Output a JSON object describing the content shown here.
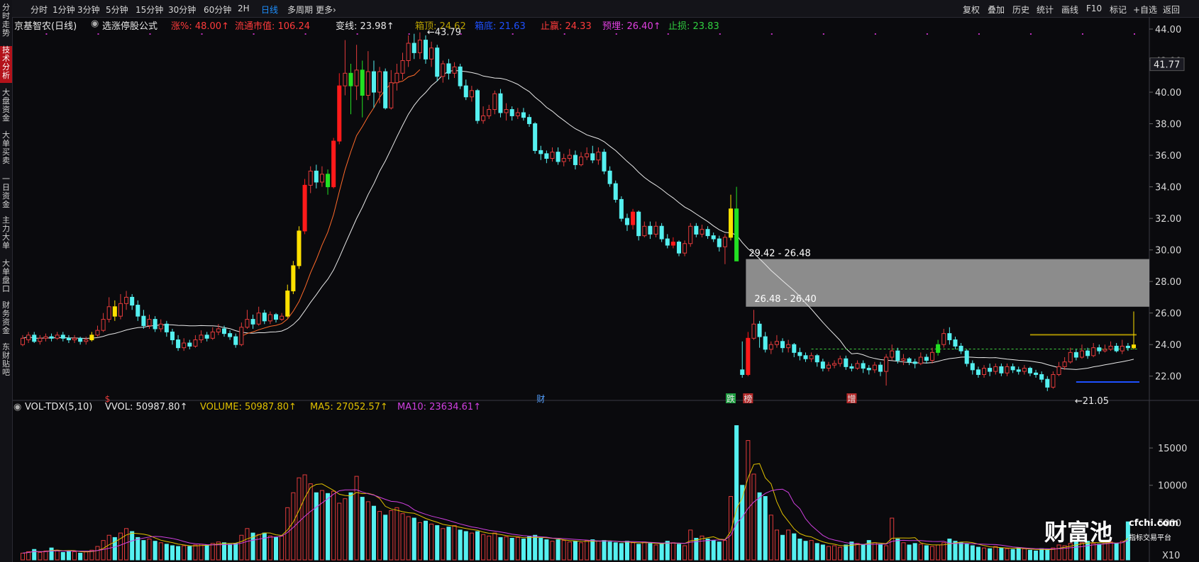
{
  "toolbar": {
    "left": [
      "分时",
      "1分钟",
      "3分钟",
      "5分钟",
      "15分钟",
      "30分钟",
      "60分钟",
      "2H",
      "日线",
      "多周期",
      "更多›"
    ],
    "active": "日线",
    "right": [
      "复权",
      "叠加",
      "历史",
      "统计",
      "画线",
      "F10",
      "标记",
      "+自选",
      "返回"
    ]
  },
  "sidebar": [
    "分时走势",
    "技术分析",
    "大盘资金",
    "大单买卖",
    "一日资金",
    "主力大单",
    "大单盘口",
    "财务资金",
    "东财贴吧"
  ],
  "sidebar_active": "技术分析",
  "info": {
    "stock": "京基智农(日线)",
    "formula": "选涨停股公式",
    "zhangfu": "涨%: 48.00↑",
    "market_cap": "流通市值: 106.24",
    "bianxian": "变线: 23.98↑",
    "box_top": "箱顶: 24.62",
    "box_bottom": "箱底: 21.63",
    "take_profit": "止赢: 24.33",
    "expect": "预埋: 26.40↑",
    "stop_loss": "止损: 23.83"
  },
  "colors": {
    "up": "#e23b3b",
    "down": "#55f0f0",
    "ma5": "#e0c000",
    "ma10": "#d040e0",
    "accent": "#1e90ff"
  },
  "price_axis": {
    "ticks": [
      "44.00",
      "42.00",
      "40.00",
      "38.00",
      "36.00",
      "34.00",
      "32.00",
      "30.00",
      "28.00",
      "26.00",
      "24.00",
      "22.00"
    ],
    "current": "41.77"
  },
  "annotations": {
    "high": "43.79",
    "low": "21.05",
    "gap_upper": "29.42 - 26.48",
    "gap_lower": "26.48 - 26.40"
  },
  "markers": {
    "m1": "$",
    "m2": "财",
    "m3": "跌",
    "m4": "榜",
    "m5": "增"
  },
  "vol_info": {
    "title": "VOL-TDX(5,10)",
    "vvol": "VVOL: 50987.80↑",
    "volume": "VOLUME: 50987.80↑",
    "ma5": "MA5: 27052.57↑",
    "ma10": "MA10: 23634.61↑"
  },
  "vol_axis": {
    "ticks": [
      "15000",
      "10000",
      "5000"
    ],
    "unit": "X10"
  },
  "watermark": {
    "logo": "财富池",
    "site": "cfchi.com",
    "tagline": "指标交易平台"
  },
  "chart_data": {
    "type": "candlestick",
    "ylim": [
      21,
      44
    ],
    "candles": [
      [
        24.0,
        24.4,
        24.6,
        23.9
      ],
      [
        24.3,
        24.6,
        24.8,
        24.1
      ],
      [
        24.6,
        24.2,
        24.8,
        24.1
      ],
      [
        24.2,
        24.4,
        24.6,
        24.0
      ],
      [
        24.4,
        24.5,
        24.7,
        24.2
      ],
      [
        24.5,
        24.4,
        24.7,
        24.2
      ],
      [
        24.4,
        24.6,
        24.8,
        24.3
      ],
      [
        24.6,
        24.4,
        24.8,
        24.2
      ],
      [
        24.4,
        24.3,
        24.6,
        24.1
      ],
      [
        24.3,
        24.4,
        24.6,
        24.1
      ],
      [
        24.4,
        24.2,
        24.5,
        24.0
      ],
      [
        24.2,
        24.3,
        24.5,
        24.0
      ],
      [
        24.3,
        24.6,
        24.8,
        24.2
      ],
      [
        24.6,
        24.9,
        25.2,
        24.5
      ],
      [
        24.9,
        25.6,
        26.0,
        24.8
      ],
      [
        25.6,
        26.4,
        27.0,
        25.4
      ],
      [
        26.4,
        25.8,
        26.8,
        25.5
      ],
      [
        25.8,
        26.6,
        27.2,
        25.6
      ],
      [
        26.6,
        27.0,
        27.4,
        26.2
      ],
      [
        27.0,
        26.5,
        27.2,
        26.2
      ],
      [
        26.5,
        25.8,
        26.8,
        25.5
      ],
      [
        25.8,
        25.2,
        26.2,
        25.0
      ],
      [
        25.2,
        25.6,
        25.9,
        25.0
      ],
      [
        25.6,
        25.0,
        25.8,
        24.8
      ],
      [
        25.0,
        25.3,
        25.6,
        24.8
      ],
      [
        25.3,
        24.8,
        25.5,
        24.5
      ],
      [
        24.8,
        24.3,
        25.0,
        24.0
      ],
      [
        24.3,
        23.8,
        24.6,
        23.6
      ],
      [
        23.8,
        24.1,
        24.4,
        23.6
      ],
      [
        24.1,
        23.9,
        24.3,
        23.7
      ],
      [
        23.9,
        24.3,
        24.6,
        23.8
      ],
      [
        24.3,
        24.6,
        24.9,
        24.1
      ],
      [
        24.6,
        24.4,
        24.8,
        24.2
      ],
      [
        24.4,
        24.8,
        25.1,
        24.3
      ],
      [
        24.8,
        25.0,
        25.3,
        24.6
      ],
      [
        25.0,
        24.7,
        25.2,
        24.5
      ],
      [
        24.7,
        24.5,
        24.9,
        24.3
      ],
      [
        24.5,
        24.0,
        24.7,
        23.8
      ],
      [
        24.0,
        25.1,
        25.4,
        23.9
      ],
      [
        25.1,
        25.6,
        26.2,
        25.0
      ],
      [
        25.6,
        25.3,
        25.9,
        25.0
      ],
      [
        25.3,
        26.0,
        26.4,
        25.2
      ],
      [
        26.0,
        25.5,
        26.2,
        25.3
      ],
      [
        25.5,
        25.9,
        26.1,
        25.3
      ],
      [
        25.9,
        25.6,
        26.0,
        25.4
      ],
      [
        25.6,
        25.8,
        26.0,
        25.5
      ],
      [
        25.8,
        27.4,
        27.8,
        25.7
      ],
      [
        27.4,
        29.0,
        29.3,
        27.2
      ],
      [
        29.0,
        31.2,
        31.5,
        28.8
      ],
      [
        31.2,
        34.1,
        34.5,
        31.0
      ],
      [
        34.1,
        35.0,
        35.3,
        33.6
      ],
      [
        35.0,
        34.3,
        35.4,
        33.9
      ],
      [
        34.3,
        34.8,
        35.3,
        34.0
      ],
      [
        34.8,
        34.0,
        35.1,
        33.5
      ],
      [
        34.0,
        36.9,
        37.1,
        33.9
      ],
      [
        36.9,
        40.4,
        41.2,
        36.7
      ],
      [
        40.4,
        41.2,
        43.3,
        39.8
      ],
      [
        41.2,
        40.4,
        41.8,
        38.6
      ],
      [
        40.4,
        41.4,
        43.0,
        39.5
      ],
      [
        41.4,
        39.8,
        42.0,
        38.4
      ],
      [
        39.8,
        41.3,
        42.6,
        39.5
      ],
      [
        41.3,
        40.0,
        42.0,
        39.0
      ],
      [
        40.0,
        41.3,
        41.6,
        39.3
      ],
      [
        41.3,
        39.0,
        41.5,
        38.9
      ],
      [
        39.0,
        40.6,
        41.4,
        38.9
      ],
      [
        40.6,
        41.2,
        41.8,
        40.1
      ],
      [
        41.2,
        42.0,
        42.5,
        40.8
      ],
      [
        42.0,
        43.1,
        43.6,
        41.6
      ],
      [
        43.1,
        42.5,
        43.7,
        42.1
      ],
      [
        42.5,
        43.3,
        43.79,
        42.1
      ],
      [
        43.3,
        42.1,
        43.6,
        41.8
      ],
      [
        42.1,
        42.8,
        43.2,
        41.6
      ],
      [
        42.8,
        41.0,
        43.0,
        40.7
      ],
      [
        41.0,
        41.8,
        42.0,
        40.6
      ],
      [
        41.8,
        41.2,
        42.1,
        40.8
      ],
      [
        41.2,
        41.6,
        41.9,
        40.9
      ],
      [
        41.6,
        40.4,
        41.8,
        40.2
      ],
      [
        40.4,
        39.7,
        40.8,
        39.5
      ],
      [
        39.7,
        40.1,
        40.4,
        39.4
      ],
      [
        40.1,
        38.2,
        40.2,
        38.0
      ],
      [
        38.2,
        38.5,
        39.1,
        38.0
      ],
      [
        38.5,
        38.9,
        39.2,
        38.3
      ],
      [
        38.9,
        39.9,
        40.1,
        38.6
      ],
      [
        39.9,
        38.7,
        40.2,
        38.4
      ],
      [
        38.7,
        38.9,
        39.3,
        38.2
      ],
      [
        38.9,
        38.5,
        39.1,
        38.2
      ],
      [
        38.5,
        38.7,
        39.0,
        38.3
      ],
      [
        38.7,
        38.4,
        39.0,
        38.2
      ],
      [
        38.4,
        38.0,
        38.6,
        37.8
      ],
      [
        38.0,
        36.3,
        38.1,
        36.1
      ],
      [
        36.3,
        36.1,
        36.6,
        35.7
      ],
      [
        36.1,
        35.8,
        36.3,
        35.5
      ],
      [
        35.8,
        36.2,
        36.5,
        35.6
      ],
      [
        36.2,
        35.6,
        36.5,
        35.4
      ],
      [
        35.6,
        35.8,
        36.1,
        35.3
      ],
      [
        35.8,
        36.0,
        36.4,
        35.6
      ],
      [
        36.0,
        35.4,
        36.3,
        35.1
      ],
      [
        35.4,
        35.9,
        36.2,
        35.3
      ],
      [
        35.9,
        36.1,
        36.5,
        35.7
      ],
      [
        36.1,
        35.7,
        36.6,
        35.5
      ],
      [
        35.7,
        36.2,
        36.5,
        35.4
      ],
      [
        36.2,
        35.0,
        36.4,
        34.8
      ],
      [
        35.0,
        34.2,
        35.3,
        34.0
      ],
      [
        34.2,
        33.2,
        34.4,
        33.0
      ],
      [
        33.2,
        32.0,
        33.4,
        31.8
      ],
      [
        32.0,
        31.6,
        32.3,
        31.2
      ],
      [
        31.6,
        32.4,
        32.6,
        31.3
      ],
      [
        32.4,
        30.9,
        32.5,
        30.6
      ],
      [
        30.9,
        31.5,
        31.8,
        30.8
      ],
      [
        31.5,
        31.0,
        31.8,
        30.7
      ],
      [
        31.0,
        31.5,
        31.8,
        30.8
      ],
      [
        31.5,
        30.7,
        31.7,
        30.5
      ],
      [
        30.7,
        30.3,
        31.0,
        30.1
      ],
      [
        30.3,
        30.5,
        30.8,
        30.1
      ],
      [
        30.5,
        29.8,
        30.6,
        29.6
      ],
      [
        29.8,
        30.4,
        30.6,
        29.6
      ],
      [
        30.4,
        31.5,
        31.7,
        30.2
      ],
      [
        31.5,
        31.0,
        31.7,
        30.8
      ],
      [
        31.0,
        31.3,
        31.6,
        30.8
      ],
      [
        31.3,
        30.9,
        31.5,
        30.7
      ],
      [
        30.9,
        30.7,
        31.1,
        30.5
      ],
      [
        30.7,
        30.2,
        30.9,
        29.9
      ],
      [
        30.2,
        30.8,
        31.0,
        29.1
      ],
      [
        30.8,
        32.6,
        33.5,
        30.6
      ],
      [
        32.6,
        29.3,
        34.0,
        29.3
      ],
      [
        22.4,
        22.1,
        24.2,
        21.9
      ],
      [
        22.1,
        24.4,
        24.8,
        22.0
      ],
      [
        24.4,
        25.3,
        26.2,
        24.3
      ],
      [
        25.3,
        24.5,
        25.5,
        23.8
      ],
      [
        24.5,
        23.7,
        24.8,
        23.5
      ],
      [
        23.7,
        24.0,
        24.2,
        23.4
      ],
      [
        24.0,
        24.2,
        24.6,
        23.8
      ],
      [
        24.2,
        23.8,
        24.4,
        23.5
      ],
      [
        23.8,
        24.0,
        24.3,
        23.5
      ],
      [
        24.0,
        23.5,
        24.1,
        23.2
      ],
      [
        23.5,
        23.3,
        23.8,
        23.0
      ],
      [
        23.3,
        23.1,
        23.5,
        22.9
      ],
      [
        23.1,
        23.3,
        23.5,
        22.9
      ],
      [
        23.3,
        22.9,
        23.4,
        22.6
      ],
      [
        22.9,
        22.5,
        23.1,
        22.3
      ],
      [
        22.5,
        22.7,
        22.9,
        22.3
      ],
      [
        22.7,
        22.8,
        23.0,
        22.5
      ],
      [
        22.8,
        23.1,
        23.3,
        22.6
      ],
      [
        23.1,
        22.6,
        23.3,
        22.4
      ],
      [
        22.6,
        22.5,
        22.8,
        22.3
      ],
      [
        22.5,
        22.8,
        23.0,
        22.4
      ],
      [
        22.8,
        22.5,
        23.0,
        22.2
      ],
      [
        22.5,
        22.4,
        22.7,
        22.1
      ],
      [
        22.4,
        22.7,
        22.9,
        22.2
      ],
      [
        22.7,
        22.3,
        22.9,
        22.0
      ],
      [
        22.3,
        23.2,
        23.4,
        21.4
      ],
      [
        23.2,
        23.6,
        24.0,
        23.0
      ],
      [
        23.6,
        23.0,
        23.8,
        22.8
      ],
      [
        23.0,
        23.1,
        23.4,
        22.7
      ],
      [
        23.1,
        22.9,
        23.2,
        22.7
      ],
      [
        22.9,
        22.8,
        23.1,
        22.5
      ],
      [
        22.8,
        23.2,
        23.5,
        22.7
      ],
      [
        23.2,
        23.0,
        23.4,
        22.8
      ],
      [
        23.0,
        23.5,
        23.8,
        22.8
      ],
      [
        23.5,
        24.0,
        24.3,
        23.3
      ],
      [
        24.0,
        24.7,
        25.0,
        23.8
      ],
      [
        24.7,
        24.3,
        25.1,
        24.0
      ],
      [
        24.3,
        23.9,
        24.5,
        23.7
      ],
      [
        23.9,
        23.6,
        24.1,
        23.4
      ],
      [
        23.6,
        22.8,
        23.7,
        22.6
      ],
      [
        22.8,
        22.4,
        23.0,
        22.1
      ],
      [
        22.4,
        22.1,
        22.6,
        21.9
      ],
      [
        22.1,
        22.5,
        22.7,
        21.9
      ],
      [
        22.5,
        22.3,
        22.8,
        22.0
      ],
      [
        22.3,
        22.6,
        22.8,
        22.1
      ],
      [
        22.6,
        22.2,
        22.8,
        22.0
      ],
      [
        22.2,
        22.6,
        22.8,
        22.0
      ],
      [
        22.6,
        22.4,
        22.8,
        22.2
      ],
      [
        22.4,
        22.3,
        22.6,
        22.1
      ],
      [
        22.3,
        22.5,
        22.7,
        22.1
      ],
      [
        22.5,
        22.2,
        22.6,
        22.0
      ],
      [
        22.2,
        22.1,
        22.4,
        21.9
      ],
      [
        22.1,
        21.8,
        22.3,
        21.6
      ],
      [
        21.8,
        21.3,
        22.0,
        21.05
      ],
      [
        21.3,
        22.1,
        22.3,
        21.2
      ],
      [
        22.1,
        22.6,
        22.9,
        22.0
      ],
      [
        22.6,
        22.9,
        23.2,
        22.4
      ],
      [
        22.9,
        23.5,
        23.8,
        22.8
      ],
      [
        23.5,
        23.2,
        23.7,
        23.0
      ],
      [
        23.2,
        23.6,
        24.0,
        23.1
      ],
      [
        23.6,
        23.3,
        23.8,
        23.1
      ],
      [
        23.3,
        23.8,
        24.1,
        23.2
      ],
      [
        23.8,
        23.6,
        24.0,
        23.4
      ],
      [
        23.6,
        23.7,
        24.0,
        23.5
      ],
      [
        23.7,
        23.9,
        24.2,
        23.6
      ],
      [
        23.9,
        23.6,
        24.1,
        23.5
      ],
      [
        23.6,
        23.9,
        24.3,
        23.4
      ],
      [
        23.9,
        23.8,
        24.1,
        23.6
      ],
      [
        23.8,
        23.98,
        26.1,
        23.7
      ]
    ],
    "volume": [
      900,
      1100,
      1400,
      1000,
      1200,
      1600,
      1300,
      1000,
      1200,
      1100,
      900,
      1100,
      1300,
      1800,
      2600,
      3300,
      3000,
      3600,
      4200,
      3800,
      3000,
      2600,
      2800,
      2500,
      2300,
      2100,
      1900,
      1800,
      1900,
      1800,
      2000,
      2100,
      2000,
      2200,
      2400,
      2300,
      2100,
      2200,
      3300,
      4200,
      3600,
      3400,
      3600,
      3200,
      3000,
      3200,
      7000,
      9000,
      11000,
      11400,
      10200,
      9000,
      9300,
      8900,
      9200,
      7600,
      8200,
      9000,
      11200,
      8400,
      7800,
      7200,
      6500,
      6000,
      6600,
      7000,
      6200,
      5800,
      5600,
      5000,
      5200,
      4800,
      4600,
      4200,
      4400,
      4600,
      4000,
      3800,
      3600,
      3800,
      3400,
      3200,
      3600,
      3000,
      3100,
      2900,
      3000,
      2800,
      3100,
      3300,
      2900,
      2700,
      2500,
      2700,
      2600,
      2400,
      2500,
      2300,
      2600,
      2700,
      2500,
      2600,
      2400,
      2300,
      2200,
      2500,
      2300,
      2100,
      2400,
      2200,
      2000,
      2200,
      2500,
      2300,
      2100,
      1900,
      4000,
      2900,
      3200,
      2800,
      2600,
      2400,
      2600,
      8500,
      18000,
      10000,
      16000,
      11500,
      9000,
      8500,
      6000,
      4000,
      3300,
      4000,
      3500,
      2800,
      2500,
      2600,
      2200,
      2000,
      1800,
      1900,
      1700,
      2000,
      2400,
      2200,
      2000,
      2600,
      2300,
      2100,
      1900,
      5600,
      2800,
      2300,
      2000,
      2200,
      2100,
      1900,
      1800,
      2000,
      2300,
      2800,
      2500,
      2300,
      2100,
      1900,
      1700,
      1600,
      1500,
      1800,
      1600,
      1500,
      1400,
      1600,
      1500,
      1300,
      1200,
      1500,
      1400,
      1600,
      2000,
      1900,
      2200,
      2400,
      2300,
      2500,
      2200,
      2100,
      2300,
      2400,
      2200,
      2500,
      5100
    ]
  }
}
